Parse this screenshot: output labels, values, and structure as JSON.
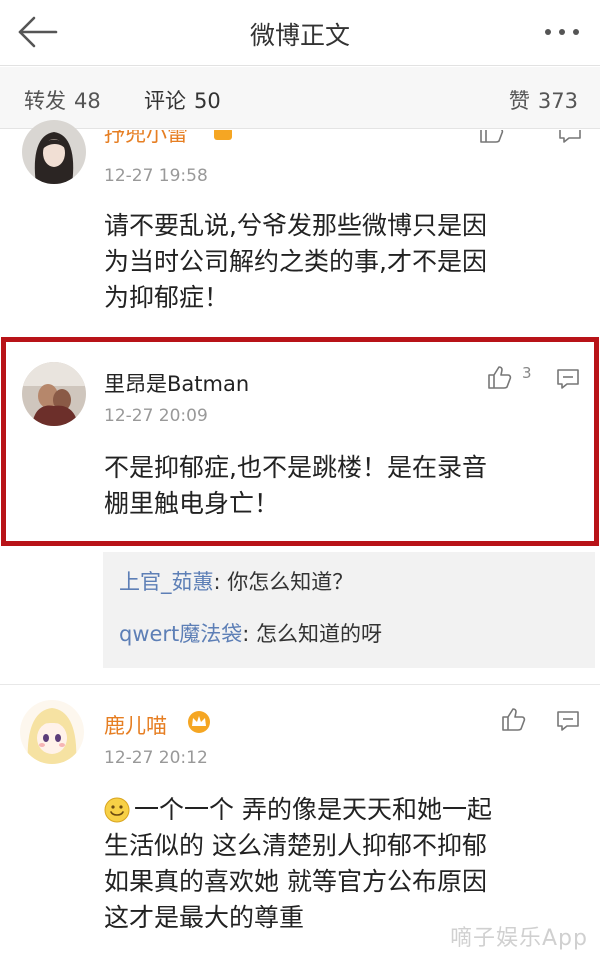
{
  "header": {
    "title": "微博正文"
  },
  "stats": {
    "repost_label": "转发",
    "repost_count": "48",
    "comment_label": "评论",
    "comment_count": "50",
    "like_label": "赞",
    "like_count": "373"
  },
  "comments": [
    {
      "name": "抒兜小雷",
      "time": "12-27 19:58",
      "text_lines": [
        "请不要乱说,兮爷发那些微博只是因",
        "为当时公司解约之类的事,才不是因",
        "为抑郁症！"
      ]
    },
    {
      "name": "里昂是Batman",
      "time": "12-27 20:09",
      "like_count": "3",
      "text_lines": [
        "不是抑郁症,也不是跳楼！是在录音",
        "棚里触电身亡！"
      ],
      "replies": [
        {
          "name": "上官_茹蕙",
          "text": ": 你怎么知道？"
        },
        {
          "name": "qwert魔法袋",
          "text": ": 怎么知道的呀"
        }
      ]
    },
    {
      "name": "鹿儿喵",
      "time": "12-27 20:12",
      "text_lines": [
        "一个一个 弄的像是天天和她一起",
        "生活似的 这么清楚别人抑郁不抑郁",
        "如果真的喜欢她 就等官方公布原因",
        "这才是最大的尊重"
      ]
    }
  ],
  "watermark": "嘀子娱乐App",
  "colors": {
    "highlight_border": "#b81318",
    "username": "#e67e22",
    "reply_name": "#5d7fb6"
  },
  "icons": {
    "back": "arrow-left-icon",
    "more": "more-dots-icon",
    "like": "thumbs-up-icon",
    "reply": "comment-bubble-icon",
    "vip": "crown-icon",
    "smile": "smile-emoji-icon"
  }
}
